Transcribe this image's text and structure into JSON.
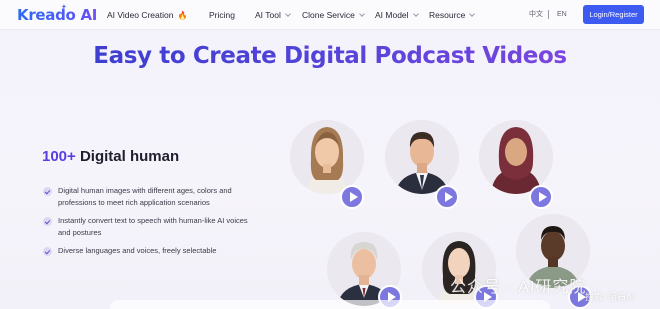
{
  "nav": {
    "logo": "Kreado AI",
    "items": [
      {
        "label": "AI Video Creation",
        "has_fire": true,
        "has_chevron": false
      },
      {
        "label": "Pricing",
        "has_fire": false,
        "has_chevron": false
      },
      {
        "label": "AI Tool",
        "has_fire": false,
        "has_chevron": true
      },
      {
        "label": "Clone Service",
        "has_fire": false,
        "has_chevron": true
      },
      {
        "label": "AI Model",
        "has_fire": false,
        "has_chevron": true
      },
      {
        "label": "Resource",
        "has_fire": false,
        "has_chevron": true
      }
    ],
    "lang_zh": "中文",
    "lang_en": "EN",
    "login_label": "Login/Register"
  },
  "hero": {
    "title": "Easy to Create Digital Podcast Videos"
  },
  "feature": {
    "title_highlight": "100+",
    "title_rest": " Digital human",
    "bullets": [
      "Digital human images with different ages, colors and professions to meet rich application scenarios",
      "Instantly convert text to speech with human-like AI voices and postures",
      "Diverse languages and voices, freely selectable"
    ]
  },
  "avatars": [
    {
      "name": "avatar-woman-blonde"
    },
    {
      "name": "avatar-man-suit"
    },
    {
      "name": "avatar-woman-hijab"
    },
    {
      "name": "avatar-man-older"
    },
    {
      "name": "avatar-woman-young"
    },
    {
      "name": "avatar-man-young"
    }
  ],
  "watermark": {
    "line1": "公众号 · AI研究院",
    "line2": "搜索: 陌石AI"
  },
  "colors": {
    "accent": "#3d5bf0",
    "title_purple": "#5143d8",
    "play_button": "#7d78df"
  }
}
